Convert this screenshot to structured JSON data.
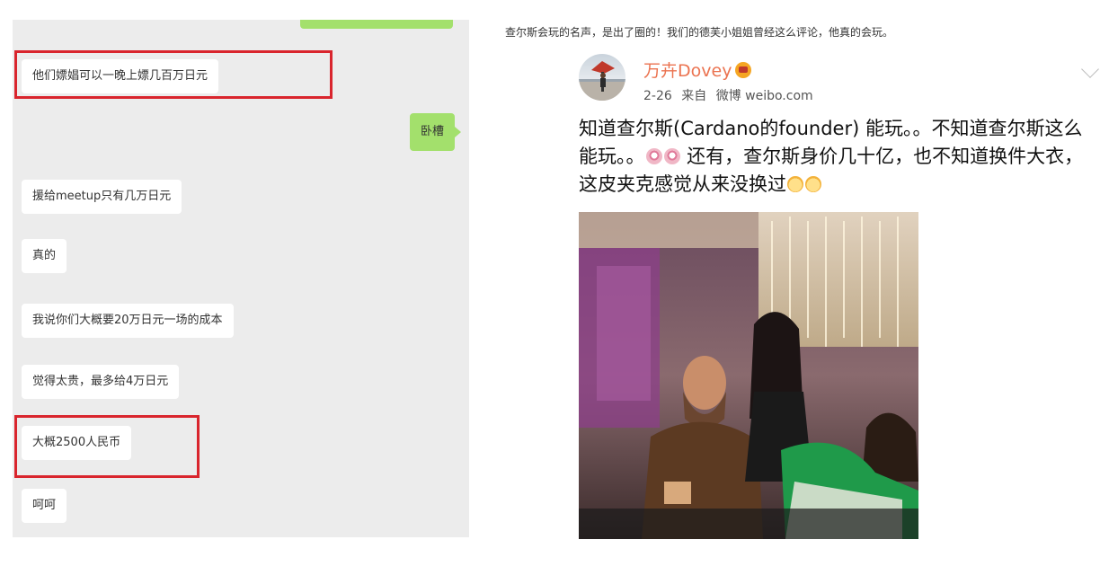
{
  "chat": {
    "messages": [
      {
        "text": "他们嫖娼可以一晚上嫖几百万日元"
      },
      {
        "text": "卧槽"
      },
      {
        "text": "援给meetup只有几万日元"
      },
      {
        "text": "真的"
      },
      {
        "text": "我说你们大概要20万日元一场的成本"
      },
      {
        "text": "觉得太贵，最多给4万日元"
      },
      {
        "text": "大概2500人民币"
      },
      {
        "text": "呵呵"
      }
    ],
    "highlight_color": "#d9252d",
    "bubble_green": "#a3e06c"
  },
  "article": {
    "caption": "查尔斯会玩的名声，是出了圈的！我们的德芙小姐姐曾经这么评论，他真的会玩。"
  },
  "post": {
    "username": "万卉Dovey",
    "date": "2-26",
    "source_prefix": "来自",
    "source": "微博 weibo.com",
    "text_part1": "知道查尔斯(Cardano的founder) 能玩。。不知道查尔斯这么能玩。。",
    "text_part2": " 还有，查尔斯身价几十亿，也不知道换件大衣，这皮夹克感觉从来没换过",
    "icons": [
      "vip-badge-icon",
      "dizzy-face-icon",
      "cat-smile-icon",
      "chevron-down-icon"
    ],
    "username_color": "#eb7350"
  }
}
